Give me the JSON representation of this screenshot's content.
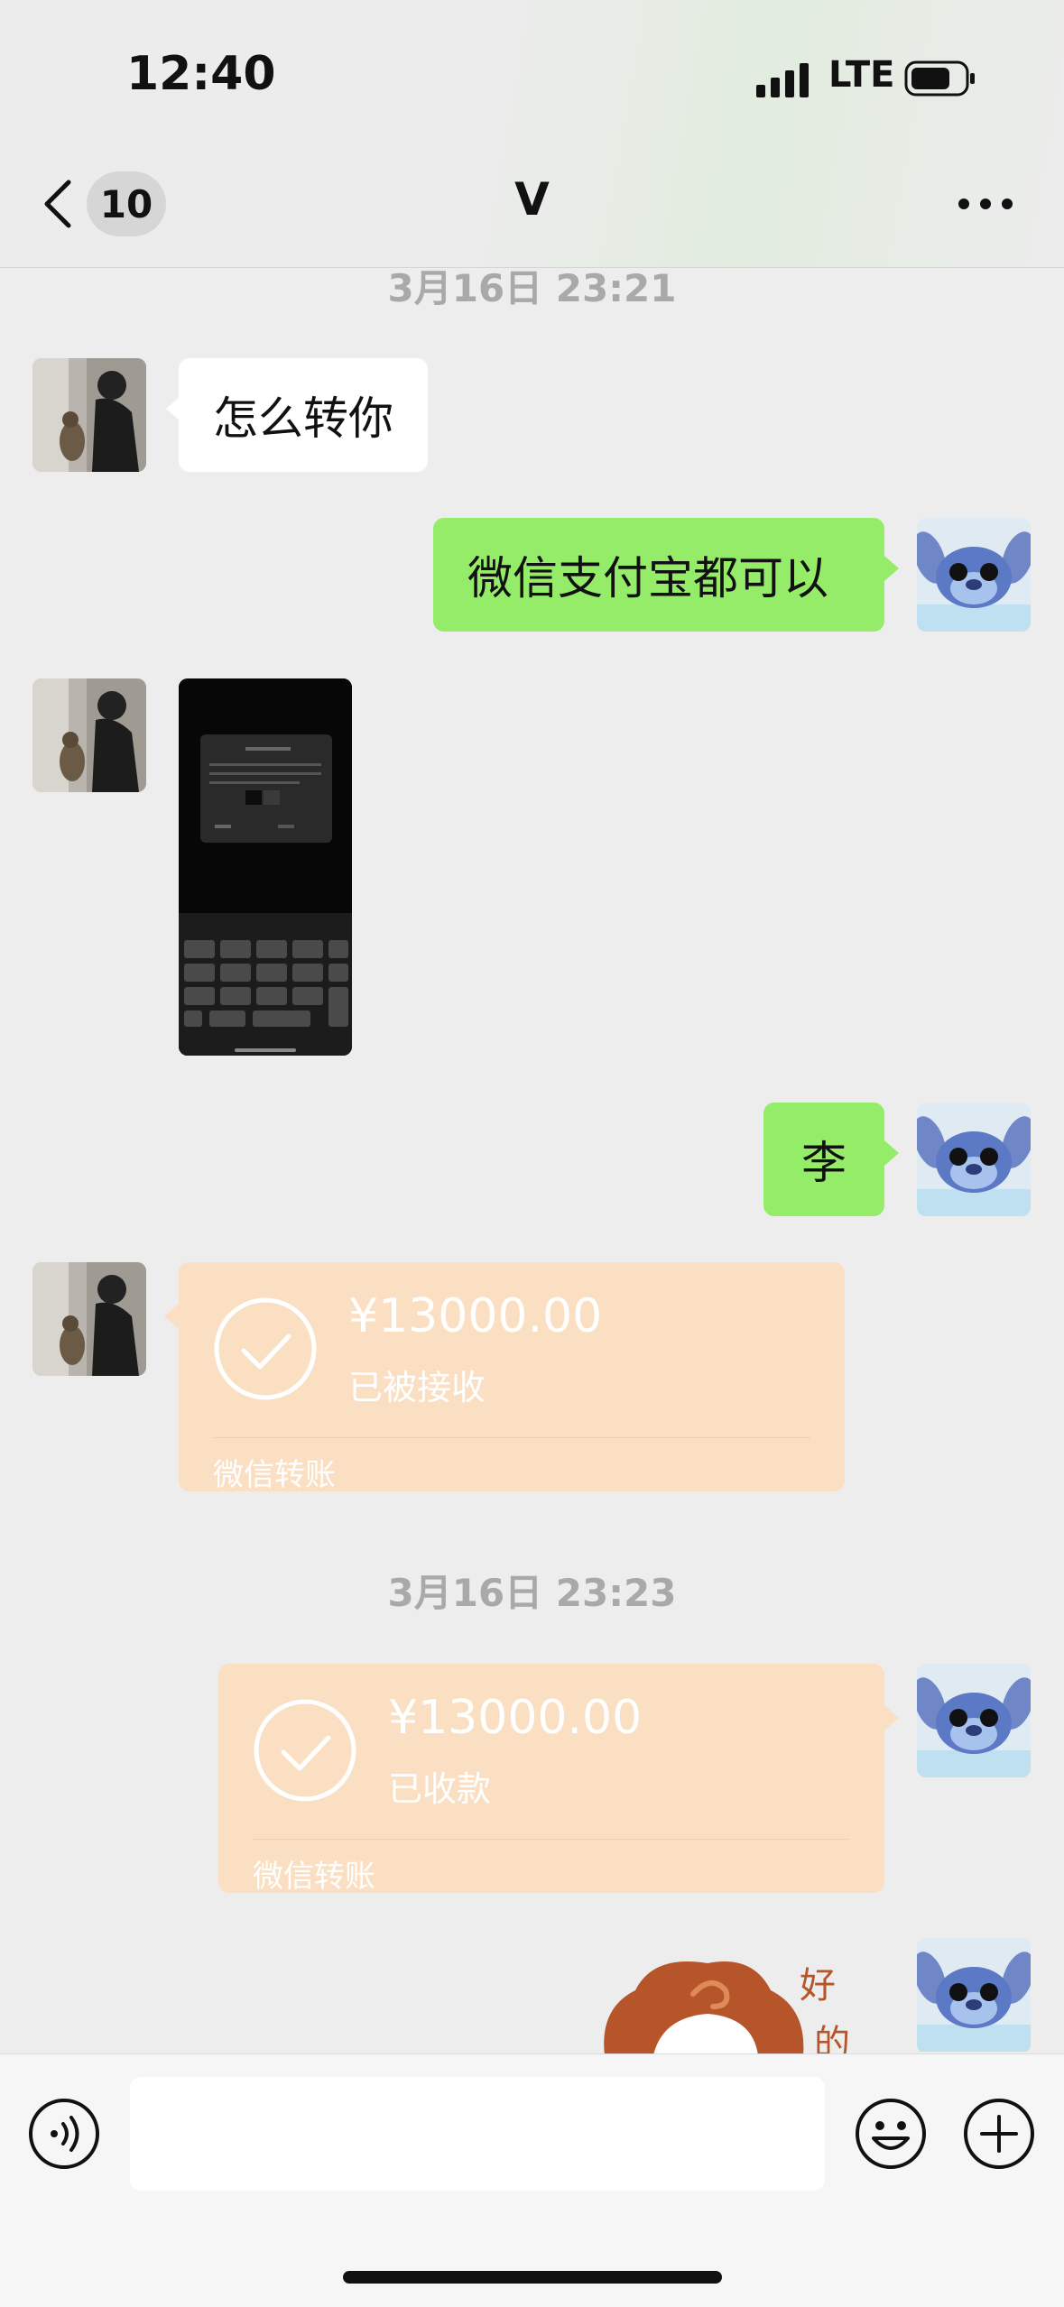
{
  "status_bar": {
    "time": "12:40",
    "network": "LTE",
    "icons": [
      "signal-icon",
      "battery-icon"
    ]
  },
  "header": {
    "unread_count": "10",
    "title": "V",
    "icons": [
      "back-chevron-icon",
      "more-icon"
    ]
  },
  "messages": [
    {
      "type": "timestamp",
      "text": "3月16日 23:21"
    },
    {
      "type": "text",
      "side": "left",
      "text": "怎么转你"
    },
    {
      "type": "text",
      "side": "right",
      "text": "微信支付宝都可以"
    },
    {
      "type": "image",
      "side": "left"
    },
    {
      "type": "text",
      "side": "right",
      "text": "李"
    },
    {
      "type": "transfer",
      "side": "left",
      "amount": "¥13000.00",
      "status": "已被接收",
      "label": "微信转账"
    },
    {
      "type": "timestamp",
      "text": "3月16日 23:23"
    },
    {
      "type": "transfer",
      "side": "right",
      "amount": "¥13000.00",
      "status": "已收款",
      "label": "微信转账"
    },
    {
      "type": "sticker",
      "side": "right",
      "text": "好的"
    }
  ],
  "input_bar": {
    "icons": [
      "voice-icon",
      "emoji-icon",
      "plus-icon"
    ]
  },
  "colors": {
    "green_bubble": "#95ec69",
    "transfer_card": "#fbdfc2",
    "background": "#ededed"
  }
}
